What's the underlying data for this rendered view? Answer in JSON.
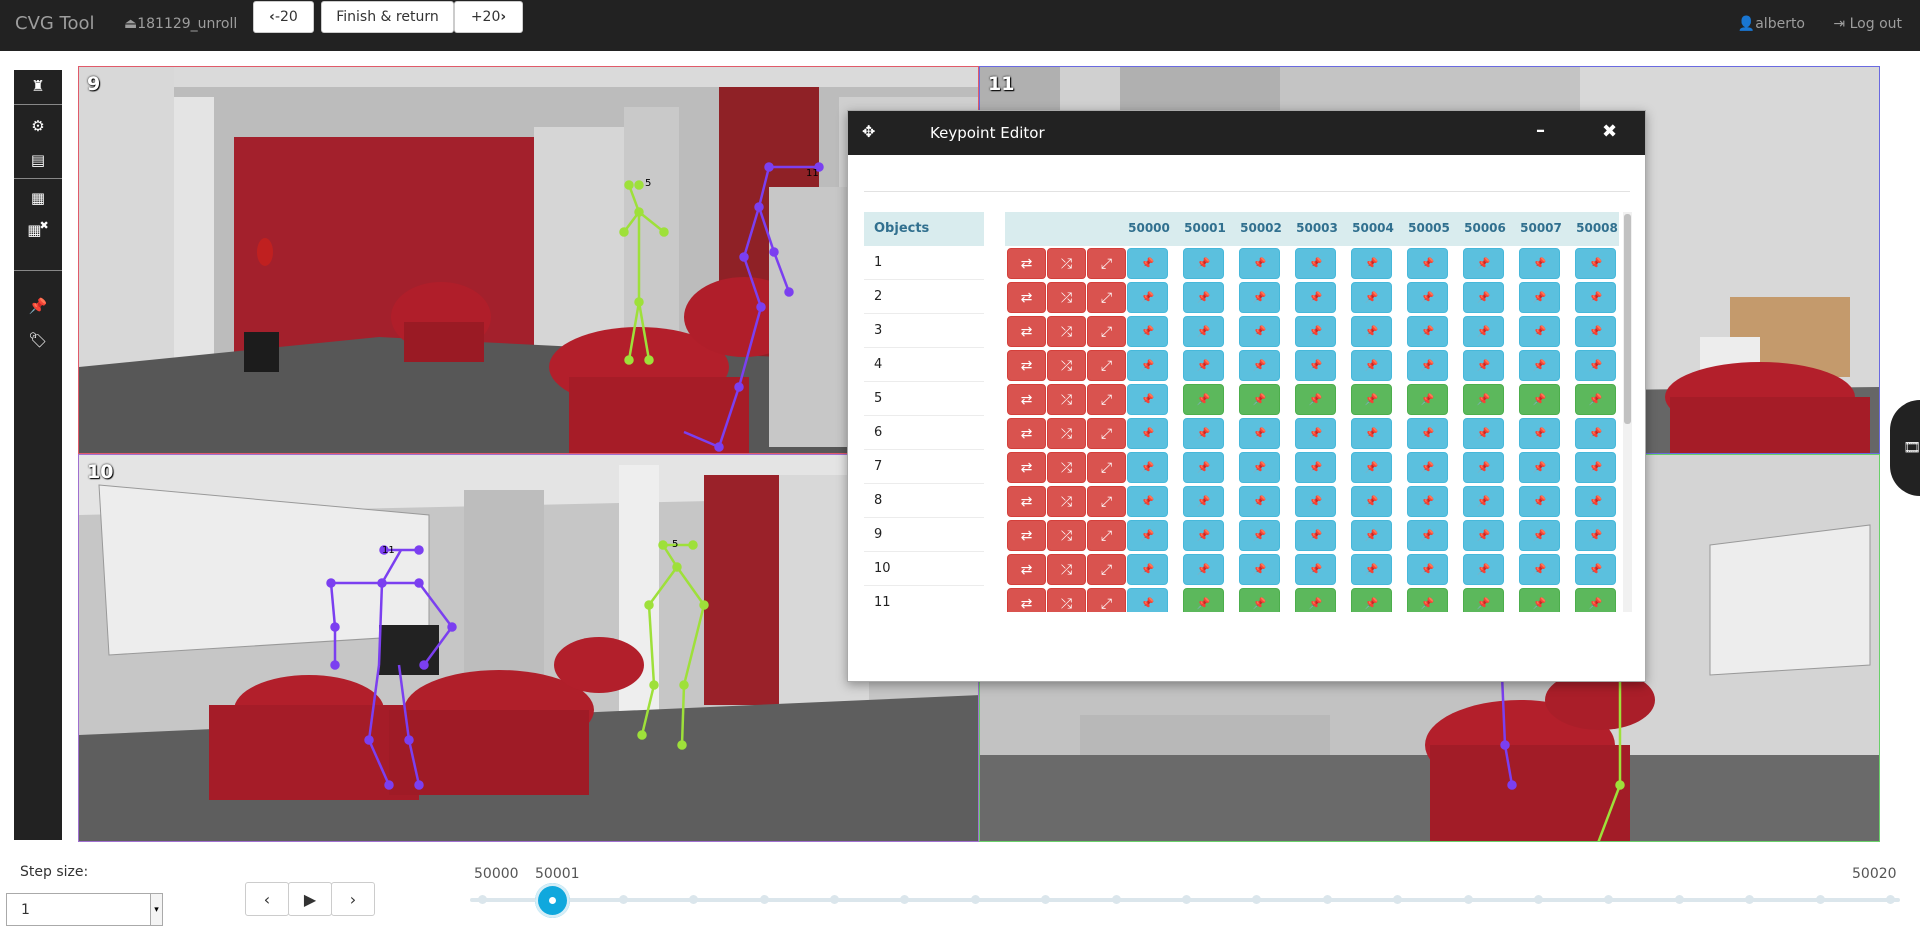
{
  "app": {
    "brand": "CVG Tool",
    "session": "181129_unroll",
    "prev_label": "-20",
    "finish_label": "Finish & return",
    "next_label": "+20",
    "user": "alberto",
    "logout": "Log out"
  },
  "sidebar": {
    "icons": [
      "chess-rook-icon",
      "settings-icon",
      "list-icon",
      "grid-icon",
      "grid-remove-icon",
      "pin-icon",
      "tag-icon"
    ]
  },
  "views": [
    {
      "label": "9",
      "border": "#e05a6a"
    },
    {
      "label": "11",
      "border": "#6a6ae0"
    },
    {
      "label": "10",
      "border": "#a070d0"
    },
    {
      "label": "",
      "border": "#6ad06a"
    }
  ],
  "skeletons": {
    "colors": {
      "green": "#9ee03a",
      "purple": "#7b3ff0"
    },
    "labels": [
      "5",
      "11"
    ]
  },
  "editor": {
    "title": "Keypoint Editor",
    "objects_header": "Objects",
    "objects": [
      "1",
      "2",
      "3",
      "4",
      "5",
      "6",
      "7",
      "8",
      "9",
      "10",
      "11"
    ],
    "frames": [
      "50000",
      "50001",
      "50002",
      "50003",
      "50004",
      "50005",
      "50006",
      "50007",
      "50008"
    ],
    "action_icons": [
      "swap-icon",
      "shuffle-icon",
      "erase-pin-icon"
    ],
    "green_rows": [
      "5",
      "11"
    ],
    "colors": {
      "red": "#d9534f",
      "blue": "#5bc0de",
      "green": "#5cb85c"
    }
  },
  "controls": {
    "step_label": "Step size:",
    "step_value": "1",
    "slider_min": "50000",
    "slider_value": "50001",
    "slider_max": "50020",
    "slider_position": 0.05,
    "tick_count": 21
  }
}
